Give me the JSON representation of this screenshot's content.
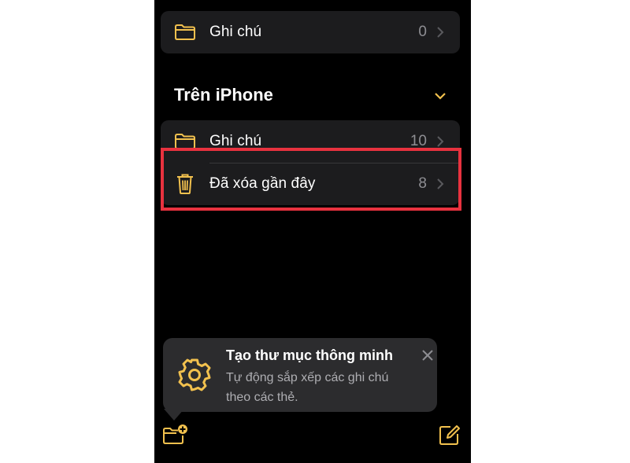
{
  "icloud": {
    "rows": [
      {
        "icon": "folder-icon",
        "label": "Ghi chú",
        "count": "0"
      }
    ]
  },
  "on_iphone": {
    "title": "Trên iPhone",
    "rows": [
      {
        "icon": "folder-icon",
        "label": "Ghi chú",
        "count": "10"
      },
      {
        "icon": "trash-icon",
        "label": "Đã xóa gần đây",
        "count": "8"
      }
    ]
  },
  "tip": {
    "icon": "gear-icon",
    "title": "Tạo thư mục thông minh",
    "body": "Tự động sắp xếp các ghi chú theo các thẻ."
  },
  "toolbar": {
    "new_folder_icon": "new-folder-icon",
    "compose_icon": "compose-icon"
  },
  "colors": {
    "accent": "#f2c14e",
    "background": "#000000",
    "group_background": "#1c1c1e",
    "tip_background": "#2c2c2e",
    "highlight": "#e8323f",
    "secondary_text": "#8e8e93"
  }
}
